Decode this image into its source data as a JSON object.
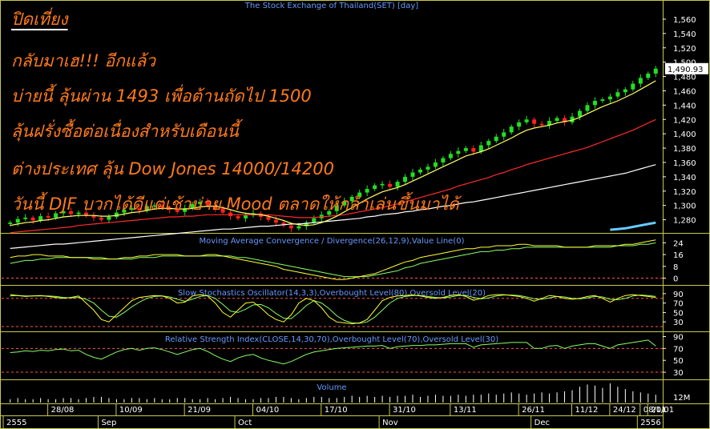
{
  "overlay_text": {
    "title": "ปิดเที่ยง",
    "lines": [
      "กลับมาเฮ!!! อีกแล้ว",
      "บ่ายนี้ ลุ้นผ่าน 1493 เพื่อต้านถัดไป 1500",
      "ลุ้นฝรั่งซื้อต่อเนื่องสำหรับเดือนนี้",
      "ต่างประเทศ ลุ้น Dow Jones 14000/14200",
      "วันนี้ DJF บวกได้ดีแต่เช้าบ่าย Mood ตลาดให้กล้าเล่นขึ้นมาได้"
    ]
  },
  "colors": {
    "background": "#000000",
    "frame": "#c9c94a",
    "axis_text": "#ffffff",
    "price_up": "#22e022",
    "price_down": "#ff2222",
    "ma_short": "#ffff66",
    "ma_mid": "#ff2a2a",
    "ma_long": "#ffffff",
    "trend_line": "#66ccff",
    "indicator_line": "#ffff33",
    "signal_line": "#88ff66",
    "dashed_level": "#ff5555",
    "volume": "#ffffff",
    "title_text": "#6699ff",
    "overlay_text": "#ff7a1a"
  },
  "chart_data": [
    {
      "type": "candlestick",
      "panel": "price",
      "title": "The Stock Exchange of Thailand(SET) [day]",
      "last_value_label": "1,490.93",
      "ylim": [
        1265,
        1570
      ],
      "y_ticks": [
        "1,560",
        "1,540",
        "1,520",
        "1,500",
        "1,480",
        "1,460",
        "1,440",
        "1,420",
        "1,400",
        "1,380",
        "1,360",
        "1,340",
        "1,320",
        "1,300",
        "1,280"
      ],
      "series": [
        {
          "name": "close",
          "values": [
            1276,
            1281,
            1283,
            1279,
            1285,
            1283,
            1289,
            1292,
            1288,
            1290,
            1286,
            1283,
            1280,
            1284,
            1290,
            1294,
            1296,
            1293,
            1299,
            1300,
            1297,
            1294,
            1291,
            1296,
            1302,
            1305,
            1300,
            1296,
            1290,
            1285,
            1282,
            1286,
            1289,
            1284,
            1280,
            1276,
            1272,
            1268,
            1271,
            1276,
            1282,
            1287,
            1292,
            1300,
            1306,
            1312,
            1318,
            1323,
            1328,
            1330,
            1326,
            1333,
            1340,
            1346,
            1350,
            1354,
            1360,
            1366,
            1372,
            1376,
            1380,
            1375,
            1384,
            1390,
            1396,
            1402,
            1410,
            1416,
            1420,
            1414,
            1412,
            1418,
            1422,
            1416,
            1424,
            1432,
            1440,
            1446,
            1448,
            1452,
            1458,
            1462,
            1470,
            1478,
            1484,
            1490.93
          ]
        },
        {
          "name": "ma_short",
          "values": [
            1272,
            1274,
            1276,
            1277,
            1279,
            1280,
            1282,
            1284,
            1285,
            1286,
            1286,
            1286,
            1285,
            1285,
            1286,
            1288,
            1290,
            1291,
            1293,
            1295,
            1296,
            1296,
            1295,
            1295,
            1296,
            1298,
            1299,
            1299,
            1297,
            1294,
            1291,
            1289,
            1288,
            1287,
            1285,
            1282,
            1279,
            1275,
            1273,
            1272,
            1273,
            1276,
            1280,
            1285,
            1291,
            1297,
            1303,
            1309,
            1314,
            1319,
            1322,
            1325,
            1329,
            1334,
            1339,
            1344,
            1349,
            1354,
            1359,
            1364,
            1369,
            1372,
            1375,
            1379,
            1384,
            1389,
            1394,
            1400,
            1405,
            1408,
            1410,
            1412,
            1415,
            1417,
            1419,
            1423,
            1428,
            1433,
            1438,
            1442,
            1446,
            1451,
            1456,
            1462,
            1468,
            1474
          ]
        },
        {
          "name": "ma_mid",
          "values": [
            1262,
            1263,
            1264,
            1265,
            1266,
            1267,
            1268,
            1269,
            1270,
            1272,
            1273,
            1274,
            1275,
            1276,
            1277,
            1278,
            1279,
            1280,
            1281,
            1282,
            1283,
            1284,
            1284,
            1285,
            1285,
            1286,
            1287,
            1287,
            1287,
            1287,
            1287,
            1287,
            1287,
            1287,
            1287,
            1286,
            1285,
            1284,
            1283,
            1283,
            1283,
            1284,
            1285,
            1286,
            1287,
            1289,
            1291,
            1293,
            1295,
            1297,
            1300,
            1302,
            1305,
            1308,
            1311,
            1314,
            1317,
            1320,
            1323,
            1327,
            1330,
            1333,
            1336,
            1339,
            1343,
            1346,
            1350,
            1353,
            1357,
            1360,
            1363,
            1366,
            1369,
            1372,
            1375,
            1378,
            1381,
            1385,
            1389,
            1393,
            1397,
            1401,
            1405,
            1410,
            1415,
            1420
          ]
        },
        {
          "name": "ma_long",
          "values": [
            1240,
            1241,
            1242,
            1243,
            1244,
            1245,
            1246,
            1246,
            1247,
            1248,
            1249,
            1250,
            1251,
            1252,
            1253,
            1254,
            1255,
            1256,
            1257,
            1258,
            1259,
            1260,
            1261,
            1262,
            1263,
            1264,
            1265,
            1266,
            1267,
            1267,
            1268,
            1269,
            1270,
            1271,
            1271,
            1272,
            1273,
            1274,
            1274,
            1275,
            1276,
            1277,
            1278,
            1279,
            1280,
            1281,
            1282,
            1284,
            1285,
            1287,
            1288,
            1289,
            1291,
            1292,
            1294,
            1295,
            1297,
            1299,
            1300,
            1302,
            1304,
            1305,
            1307,
            1309,
            1311,
            1313,
            1315,
            1317,
            1319,
            1321,
            1323,
            1325,
            1327,
            1329,
            1331,
            1333,
            1335,
            1337,
            1339,
            1341,
            1343,
            1345,
            1348,
            1351,
            1354,
            1357
          ]
        },
        {
          "name": "trend",
          "values": [
            1266,
            1267,
            1268,
            1270,
            1272,
            1274,
            1276
          ]
        }
      ]
    },
    {
      "type": "line",
      "panel": "macd",
      "title": "Moving Average Convergence / Divergence(26,12,9),Value Line(0)",
      "ylim": [
        -3,
        28
      ],
      "y_ticks": [
        "24",
        "16",
        "8",
        "0"
      ],
      "reference_value": 0,
      "series": [
        {
          "name": "macd",
          "values": [
            14,
            15,
            15,
            16,
            16,
            15,
            15,
            15,
            14,
            14,
            14,
            13,
            13,
            13,
            13,
            14,
            14,
            15,
            15,
            16,
            16,
            16,
            16,
            15,
            15,
            15,
            16,
            16,
            15,
            14,
            13,
            12,
            11,
            10,
            9,
            8,
            6,
            5,
            4,
            3,
            2,
            1,
            0,
            -1,
            -1,
            0,
            1,
            2,
            3,
            5,
            7,
            9,
            11,
            12,
            14,
            15,
            16,
            17,
            18,
            19,
            20,
            20,
            21,
            21,
            22,
            22,
            22,
            23,
            23,
            22,
            22,
            22,
            22,
            21,
            21,
            21,
            21,
            22,
            22,
            22,
            22,
            23,
            23,
            24,
            25,
            26
          ]
        },
        {
          "name": "signal",
          "values": [
            10,
            11,
            12,
            12,
            13,
            13,
            14,
            14,
            14,
            14,
            14,
            14,
            14,
            13,
            13,
            13,
            13,
            14,
            14,
            14,
            15,
            15,
            15,
            15,
            15,
            15,
            15,
            15,
            15,
            15,
            14,
            14,
            13,
            12,
            11,
            10,
            9,
            8,
            7,
            6,
            5,
            4,
            3,
            2,
            1,
            1,
            1,
            1,
            2,
            3,
            4,
            5,
            7,
            8,
            10,
            11,
            12,
            13,
            14,
            15,
            16,
            17,
            18,
            18,
            19,
            19,
            20,
            20,
            21,
            21,
            21,
            21,
            21,
            21,
            21,
            21,
            21,
            21,
            21,
            21,
            22,
            22,
            22,
            23,
            23,
            24
          ]
        }
      ]
    },
    {
      "type": "line",
      "panel": "stochastic",
      "title": "Slow Stochastics Oscillator(14,3,3),Overbought Level(80),Oversold Level(20)",
      "ylim": [
        15,
        100
      ],
      "y_ticks": [
        "90",
        "70",
        "50",
        "30"
      ],
      "reference_levels": [
        80,
        20
      ],
      "series": [
        {
          "name": "k",
          "values": [
            88,
            86,
            84,
            85,
            86,
            84,
            82,
            80,
            82,
            85,
            70,
            55,
            35,
            30,
            45,
            60,
            75,
            82,
            84,
            86,
            85,
            80,
            70,
            72,
            85,
            88,
            85,
            70,
            50,
            40,
            55,
            70,
            72,
            60,
            45,
            35,
            30,
            45,
            70,
            80,
            75,
            60,
            40,
            30,
            28,
            26,
            28,
            35,
            55,
            75,
            82,
            85,
            86,
            87,
            85,
            82,
            80,
            82,
            86,
            88,
            84,
            76,
            80,
            86,
            88,
            88,
            86,
            84,
            80,
            74,
            80,
            86,
            84,
            80,
            78,
            80,
            84,
            86,
            80,
            72,
            80,
            86,
            88,
            86,
            84,
            82
          ]
        },
        {
          "name": "d",
          "values": [
            85,
            86,
            85,
            85,
            85,
            85,
            84,
            82,
            81,
            82,
            78,
            70,
            55,
            42,
            40,
            50,
            62,
            72,
            80,
            84,
            85,
            83,
            78,
            74,
            78,
            84,
            86,
            80,
            67,
            53,
            50,
            57,
            66,
            67,
            60,
            48,
            38,
            37,
            50,
            65,
            75,
            70,
            58,
            43,
            33,
            28,
            27,
            30,
            40,
            55,
            70,
            80,
            84,
            86,
            86,
            84,
            82,
            81,
            83,
            86,
            86,
            82,
            79,
            81,
            85,
            87,
            87,
            86,
            83,
            79,
            78,
            81,
            84,
            83,
            80,
            79,
            81,
            84,
            83,
            78,
            77,
            80,
            85,
            87,
            86,
            84
          ]
        }
      ]
    },
    {
      "type": "line",
      "panel": "rsi",
      "title": "Relative Strength Index(CLOSE,14,30,70),Overbought Level(70),Oversold Level(30)",
      "ylim": [
        22,
        92
      ],
      "y_ticks": [
        "90",
        "70",
        "50",
        "30"
      ],
      "reference_levels": [
        70,
        30
      ],
      "series": [
        {
          "name": "rsi",
          "values": [
            63,
            64,
            66,
            65,
            67,
            66,
            68,
            69,
            66,
            67,
            60,
            55,
            52,
            58,
            64,
            68,
            70,
            67,
            70,
            71,
            68,
            64,
            60,
            64,
            68,
            70,
            65,
            58,
            52,
            48,
            54,
            58,
            60,
            54,
            50,
            47,
            44,
            48,
            54,
            60,
            64,
            66,
            68,
            70,
            71,
            72,
            73,
            74,
            74,
            75,
            70,
            73,
            74,
            75,
            75,
            76,
            76,
            77,
            78,
            78,
            78,
            72,
            76,
            77,
            78,
            79,
            80,
            80,
            80,
            70,
            70,
            74,
            75,
            70,
            74,
            76,
            78,
            78,
            74,
            70,
            76,
            78,
            80,
            82,
            84,
            74
          ]
        }
      ]
    },
    {
      "type": "bar",
      "panel": "volume",
      "title": "Volume",
      "y_ticks": [
        "12M"
      ],
      "series": [
        {
          "name": "volume",
          "values": [
            3,
            4,
            3,
            3,
            4,
            3,
            3,
            4,
            4,
            3,
            4,
            5,
            5,
            4,
            3,
            3,
            4,
            4,
            3,
            4,
            3,
            3,
            4,
            4,
            3,
            3,
            4,
            3,
            4,
            5,
            4,
            3,
            3,
            4,
            4,
            5,
            5,
            4,
            3,
            4,
            5,
            5,
            4,
            4,
            5,
            6,
            5,
            6,
            5,
            6,
            5,
            6,
            6,
            7,
            5,
            6,
            7,
            6,
            6,
            7,
            6,
            7,
            7,
            8,
            7,
            8,
            9,
            8,
            7,
            8,
            9,
            8,
            9,
            10,
            11,
            14,
            16,
            15,
            13,
            17,
            14,
            12,
            10,
            9,
            8,
            7
          ]
        }
      ]
    }
  ],
  "x_axis": {
    "date_ticks": [
      {
        "label": "28/08",
        "index": 6
      },
      {
        "label": "10/09",
        "index": 15
      },
      {
        "label": "21/09",
        "index": 24
      },
      {
        "label": "04/10",
        "index": 33
      },
      {
        "label": "17/10",
        "index": 42
      },
      {
        "label": "31/10",
        "index": 51
      },
      {
        "label": "13/11",
        "index": 59
      },
      {
        "label": "26/11",
        "index": 68
      },
      {
        "label": "11/12",
        "index": 75
      },
      {
        "label": "24/12",
        "index": 80
      },
      {
        "label": "08/01",
        "index": 84
      },
      {
        "label": "21/01",
        "index": 85
      }
    ],
    "month_ticks": [
      {
        "label": "2555",
        "index": 0
      },
      {
        "label": "Sep",
        "index": 12
      },
      {
        "label": "Oct",
        "index": 30
      },
      {
        "label": "Nov",
        "index": 49
      },
      {
        "label": "Dec",
        "index": 69
      },
      {
        "label": "2556",
        "index": 83
      }
    ]
  }
}
